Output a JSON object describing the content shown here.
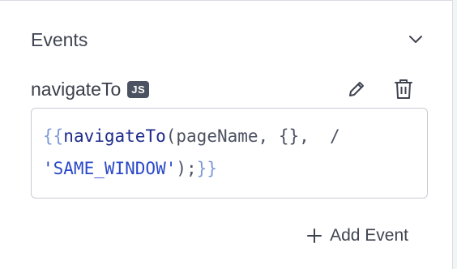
{
  "section": {
    "title": "Events"
  },
  "event": {
    "name": "navigateTo",
    "badge": "JS",
    "code": {
      "line1": {
        "open_braces": "{{",
        "function": "navigateTo",
        "open_paren": "(",
        "args": "pageName, {},  /"
      },
      "line2": {
        "string": "'SAME_WINDOW'",
        "close_paren": ");",
        "close_braces": "}}"
      }
    }
  },
  "actions": {
    "add_event_label": "Add Event"
  },
  "icons": {
    "collapse": "chevron-down-icon",
    "edit": "pencil-icon",
    "delete": "trash-icon",
    "add": "plus-icon"
  },
  "colors": {
    "badge_bg": "#4b5261",
    "brace": "#7d9ad8",
    "function": "#1d2b8a",
    "string": "#2a49c8"
  }
}
